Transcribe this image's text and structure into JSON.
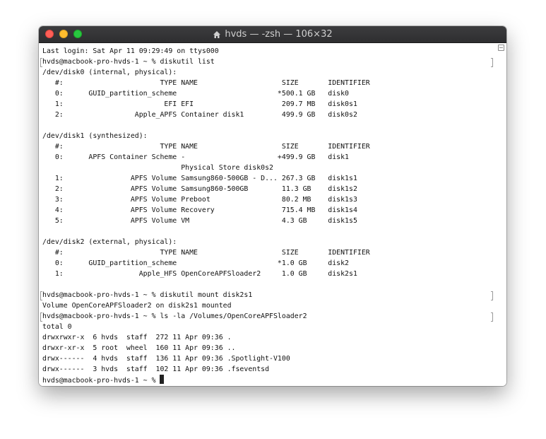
{
  "window": {
    "title": "hvds — -zsh — 106×32",
    "icon": "home-icon"
  },
  "terminal": {
    "lines": [
      "Last login: Sat Apr 11 09:29:49 on ttys000",
      "hvds@macbook-pro-hvds-1 ~ % diskutil list",
      "/dev/disk0 (internal, physical):",
      "   #:                       TYPE NAME                    SIZE       IDENTIFIER",
      "   0:      GUID_partition_scheme                        *500.1 GB   disk0",
      "   1:                        EFI EFI                     209.7 MB   disk0s1",
      "   2:                 Apple_APFS Container disk1         499.9 GB   disk0s2",
      "",
      "/dev/disk1 (synthesized):",
      "   #:                       TYPE NAME                    SIZE       IDENTIFIER",
      "   0:      APFS Container Scheme -                      +499.9 GB   disk1",
      "                                 Physical Store disk0s2",
      "   1:                APFS Volume Samsung860-500GB - D... 267.3 GB   disk1s1",
      "   2:                APFS Volume Samsung860-500GB        11.3 GB    disk1s2",
      "   3:                APFS Volume Preboot                 80.2 MB    disk1s3",
      "   4:                APFS Volume Recovery                715.4 MB   disk1s4",
      "   5:                APFS Volume VM                      4.3 GB     disk1s5",
      "",
      "/dev/disk2 (external, physical):",
      "   #:                       TYPE NAME                    SIZE       IDENTIFIER",
      "   0:      GUID_partition_scheme                        *1.0 GB     disk2",
      "   1:                  Apple_HFS OpenCoreAPFSloader2     1.0 GB     disk2s1",
      "",
      "hvds@macbook-pro-hvds-1 ~ % diskutil mount disk2s1",
      "Volume OpenCoreAPFSloader2 on disk2s1 mounted",
      "hvds@macbook-pro-hvds-1 ~ % ls -la /Volumes/OpenCoreAPFSloader2",
      "total 0",
      "drwxrwxr-x  6 hvds  staff  272 11 Apr 09:36 .",
      "drwxr-xr-x  5 root  wheel  160 11 Apr 09:36 ..",
      "drwx------  4 hvds  staff  136 11 Apr 09:36 .Spotlight-V100",
      "drwx------  3 hvds  staff  102 11 Apr 09:36 .fseventsd",
      "hvds@macbook-pro-hvds-1 ~ % "
    ],
    "marked_lines": [
      1,
      23,
      25
    ]
  }
}
